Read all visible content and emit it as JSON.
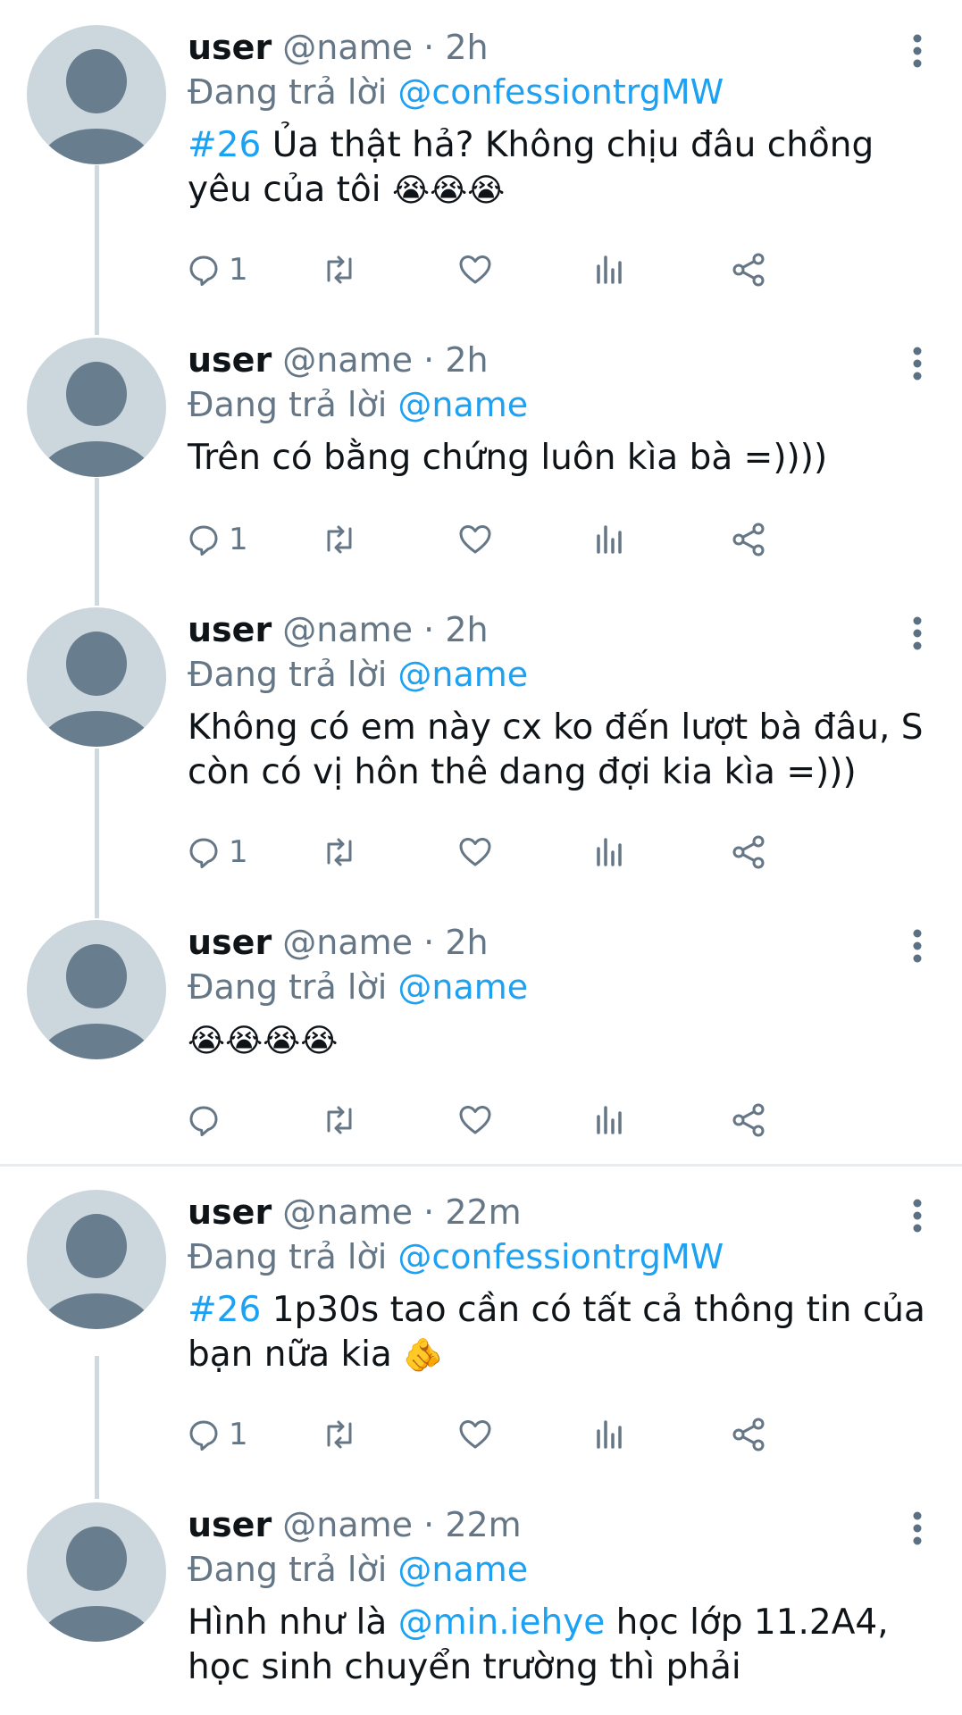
{
  "tweets": [
    {
      "user": "user",
      "handle": "@name",
      "dot": "·",
      "time": "2h",
      "reply_prefix": "Đang trả lời",
      "reply_to": "@confessiontrgMW",
      "hashtag": "#26",
      "text": " Ủa thật hả? Không chịu đâu chồng yêu của tôi ",
      "emojis": "😭😭😭",
      "mention": "",
      "text_after": "",
      "reply_count": "1"
    },
    {
      "user": "user",
      "handle": "@name",
      "dot": "·",
      "time": "2h",
      "reply_prefix": "Đang trả lời",
      "reply_to": "@name",
      "hashtag": "",
      "text": "Trên có bằng chứng luôn kìa bà =))))",
      "emojis": "",
      "mention": "",
      "text_after": "",
      "reply_count": "1"
    },
    {
      "user": "user",
      "handle": "@name",
      "dot": "·",
      "time": "2h",
      "reply_prefix": "Đang trả lời",
      "reply_to": "@name",
      "hashtag": "",
      "text": "Không có em này cx ko đến lượt bà đâu, S còn có vị hôn thê dang đợi kia kìa =)))",
      "emojis": "",
      "mention": "",
      "text_after": "",
      "reply_count": "1"
    },
    {
      "user": "user",
      "handle": "@name",
      "dot": "·",
      "time": "2h",
      "reply_prefix": "Đang trả lời",
      "reply_to": "@name",
      "hashtag": "",
      "text": "",
      "emojis": "😭😭😭😭",
      "mention": "",
      "text_after": "",
      "reply_count": ""
    },
    {
      "user": "user",
      "handle": "@name",
      "dot": "·",
      "time": "22m",
      "reply_prefix": "Đang trả lời",
      "reply_to": "@confessiontrgMW",
      "hashtag": "#26",
      "text": " 1p30s tao cần có tất cả thông tin của bạn nữa kia ",
      "emojis": "🫵",
      "mention": "",
      "text_after": "",
      "reply_count": "1"
    },
    {
      "user": "user",
      "handle": "@name",
      "dot": "·",
      "time": "22m",
      "reply_prefix": "Đang trả lời",
      "reply_to": "@name",
      "hashtag": "",
      "text": "Hình như là ",
      "emojis": "",
      "mention": "@min.iehye",
      "text_after": " học lớp 11.2A4, học sinh chuyển trường thì phải",
      "reply_count": ""
    }
  ],
  "icons": {
    "reply": "reply-icon",
    "retweet": "retweet-icon",
    "like": "like-icon",
    "analytics": "analytics-icon",
    "share": "share-icon",
    "more": "more-options-icon",
    "avatar": "default-avatar-icon"
  },
  "colors": {
    "link": "#1da1f2",
    "muted": "#657786",
    "text": "#0f1419",
    "avatar_bg": "#ccd6dd",
    "avatar_fg": "#687d8e"
  }
}
